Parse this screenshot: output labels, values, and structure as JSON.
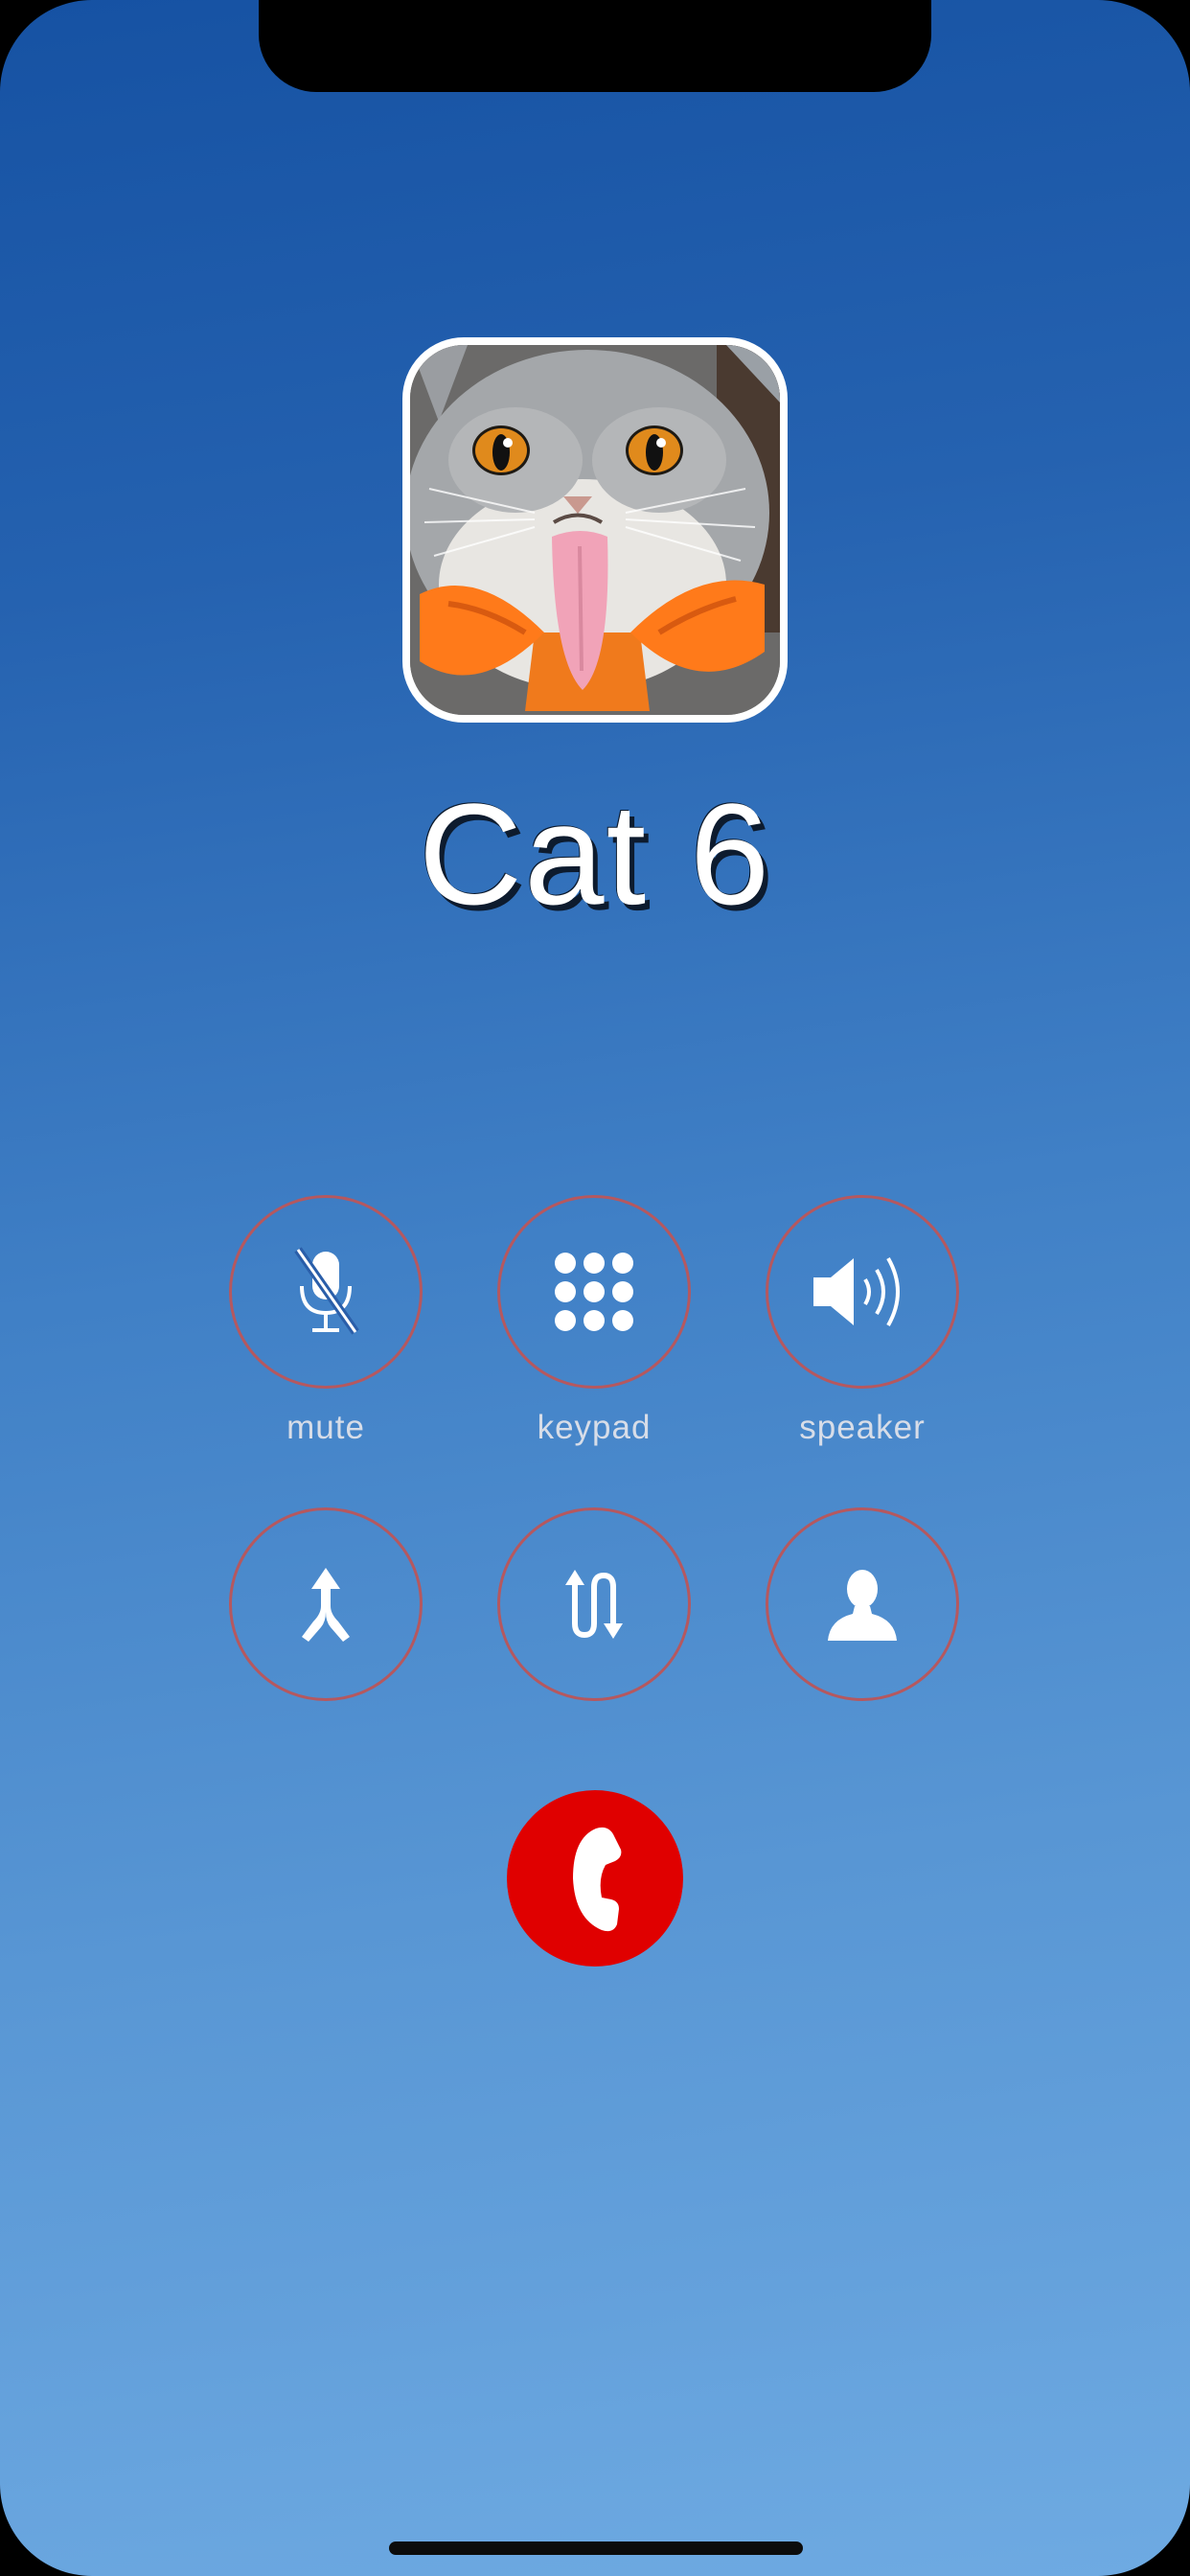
{
  "call": {
    "caller_name": "Cat 6"
  },
  "controls": {
    "mute_label": "mute",
    "keypad_label": "keypad",
    "speaker_label": "speaker"
  },
  "icons": {
    "mute": "microphone-slash-icon",
    "keypad": "keypad-grid-icon",
    "speaker": "speaker-icon",
    "merge": "merge-calls-icon",
    "swap": "swap-calls-icon",
    "contacts": "contact-person-icon",
    "end_call": "phone-handset-icon"
  },
  "colors": {
    "background_top": "#1652a3",
    "background_bottom": "#6eaae2",
    "button_ring": "#b5585f",
    "end_call": "#e00000",
    "label_text": "#d7dde8"
  }
}
